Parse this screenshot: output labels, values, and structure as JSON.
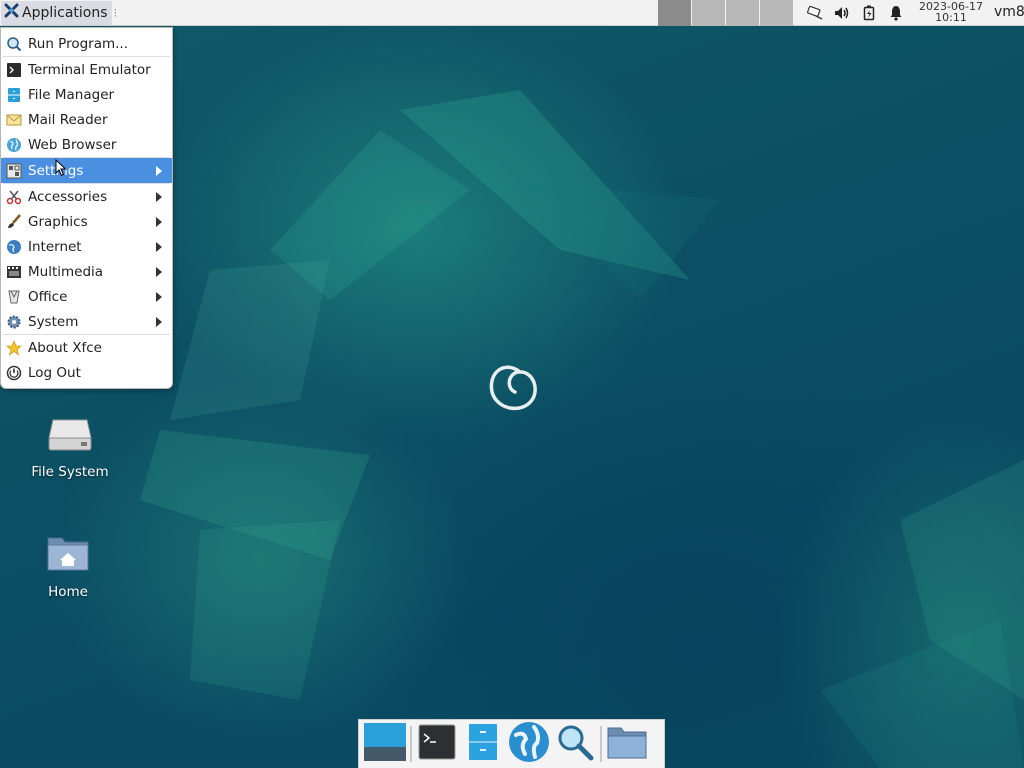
{
  "top_panel": {
    "apps_label": "Applications",
    "clock_date": "2023-06-17",
    "clock_time": "10:11",
    "username": "vm8"
  },
  "menu": {
    "items": [
      {
        "label": "Run Program...",
        "icon": "run-icon"
      },
      {
        "label": "Terminal Emulator",
        "icon": "terminal-icon"
      },
      {
        "label": "File Manager",
        "icon": "file-manager-icon"
      },
      {
        "label": "Mail Reader",
        "icon": "mail-icon"
      },
      {
        "label": "Web Browser",
        "icon": "globe-icon"
      },
      {
        "label": "Settings",
        "icon": "settings-icon",
        "submenu": true,
        "highlighted": true
      },
      {
        "label": "Accessories",
        "icon": "accessories-icon",
        "submenu": true
      },
      {
        "label": "Graphics",
        "icon": "brush-icon",
        "submenu": true
      },
      {
        "label": "Internet",
        "icon": "internet-icon",
        "submenu": true
      },
      {
        "label": "Multimedia",
        "icon": "film-icon",
        "submenu": true
      },
      {
        "label": "Office",
        "icon": "office-icon",
        "submenu": true
      },
      {
        "label": "System",
        "icon": "gear-icon",
        "submenu": true
      },
      {
        "label": "About Xfce",
        "icon": "star-icon"
      },
      {
        "label": "Log Out",
        "icon": "logout-icon"
      }
    ]
  },
  "desktop_icons": {
    "filesystem_label": "File System",
    "home_label": "Home"
  },
  "dock": {
    "items": [
      "show-desktop-icon",
      "terminal-icon",
      "file-manager-icon",
      "web-browser-icon",
      "app-finder-icon",
      "folder-icon"
    ]
  },
  "colors": {
    "menu_highlight": "#4b8fe1",
    "desktop_bg": "#0b4a5e"
  }
}
